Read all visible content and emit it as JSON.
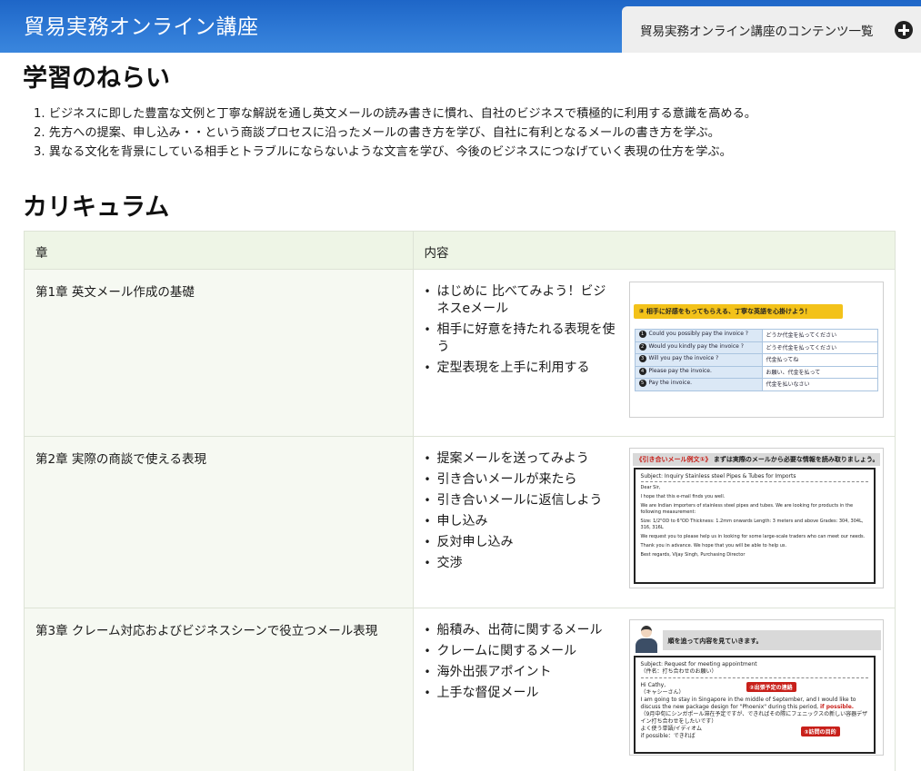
{
  "header": {
    "app_title": "貿易実務オンライン講座",
    "contents_tab_label": "貿易実務オンライン講座のコンテンツ一覧"
  },
  "aims": {
    "heading": "学習のねらい",
    "items": [
      "1. ビジネスに即した豊富な文例と丁寧な解説を通し英文メールの読み書きに慣れ、自社のビジネスで積極的に利用する意識を高める。",
      "2. 先方への提案、申し込み・・という商談プロセスに沿ったメールの書き方を学び、自社に有利となるメールの書き方を学ぶ。",
      "3. 異なる文化を背景にしている相手とトラブルにならないような文言を学び、今後のビジネスにつなげていく表現の仕方を学ぶ。"
    ]
  },
  "curriculum": {
    "heading": "カリキュラム",
    "columns": [
      "章",
      "内容"
    ],
    "rows": [
      {
        "chapter": "第1章 英文メール作成の基礎",
        "topics": [
          "はじめに 比べてみよう！ビジネスeメール",
          "相手に好意を持たれる表現を使う",
          "定型表現を上手に利用する"
        ],
        "thumb": {
          "banner": "③ 相手に好感をもってもらえる、丁寧な英語を心掛けよう！",
          "rows": [
            {
              "n": "1",
              "en": "Could you possibly pay the invoice ?",
              "jp": "どうか代金を払ってください"
            },
            {
              "n": "2",
              "en": "Would you kindly pay the invoice ?",
              "jp": "どうぞ代金を払ってください"
            },
            {
              "n": "3",
              "en": "Will you pay the invoice ?",
              "jp": "代金払ってね"
            },
            {
              "n": "4",
              "en": "Please pay the invoice.",
              "jp": "お願い、代金を払って"
            },
            {
              "n": "5",
              "en": "Pay the invoice.",
              "jp": "代金を払いなさい"
            }
          ]
        }
      },
      {
        "chapter": "第2章 実際の商談で使える表現",
        "topics": [
          "提案メールを送ってみよう",
          "引き合いメールが来たら",
          "引き合いメールに返信しよう",
          "申し込み",
          "反対申し込み",
          "交渉"
        ],
        "thumb": {
          "head_red": "《引き合いメール例文①》",
          "head_rest": "まずは実際のメールから必要な情報を読み取りましょう。",
          "subject": "Subject: Inquiry   Stainless steel Pipes & Tubes for Imports",
          "lines": [
            "Dear Sir,",
            "I hope that this e-mail finds you well.",
            "We are Indian importers of stainless steel pipes and tubes. We are looking for products in the following measurement:",
            "Size: 1/2\"OD to 6\"OD  Thickness: 1.2mm onwards  Length: 3 meters and above  Grades: 304, 304L, 316, 316L",
            "We request you to please help us in looking for some large-scale traders who can meet our needs.",
            "Thank you in advance.  We hope that you will be able to help us.",
            "Best regards,  Vijay Singh, Purchasing Director"
          ]
        }
      },
      {
        "chapter": "第3章 クレーム対応およびビジネスシーンで役立つメール表現",
        "topics": [
          "船積み、出荷に関するメール",
          "クレームに関するメール",
          "海外出張アポイント",
          "上手な督促メール"
        ],
        "thumb": {
          "head": "順を追って内容を見ていきます。",
          "subject": "Subject: Request for meeting appointment",
          "subject_jp": "（件名：打ち合わせのお願い）",
          "tag_a": "②出張予定の連絡",
          "tag_b": "③訪問の目的",
          "line1": "Hi Cathy,",
          "line2": "（キャシーさん）",
          "line3": "I am going to stay in Singapore in the middle of September, and I would like to discuss the new package design for \"Phoenix\" during this period,",
          "line3_hl": "if possible.",
          "line4": "（9月中旬にシンガポール滞在予定ですが、できればその際にフェニックスの新しい容器デザイン打ち合わせをしたいです）",
          "line5": "よく使う単語/イディオム",
          "line6": "if possible：できれば"
        }
      }
    ]
  }
}
